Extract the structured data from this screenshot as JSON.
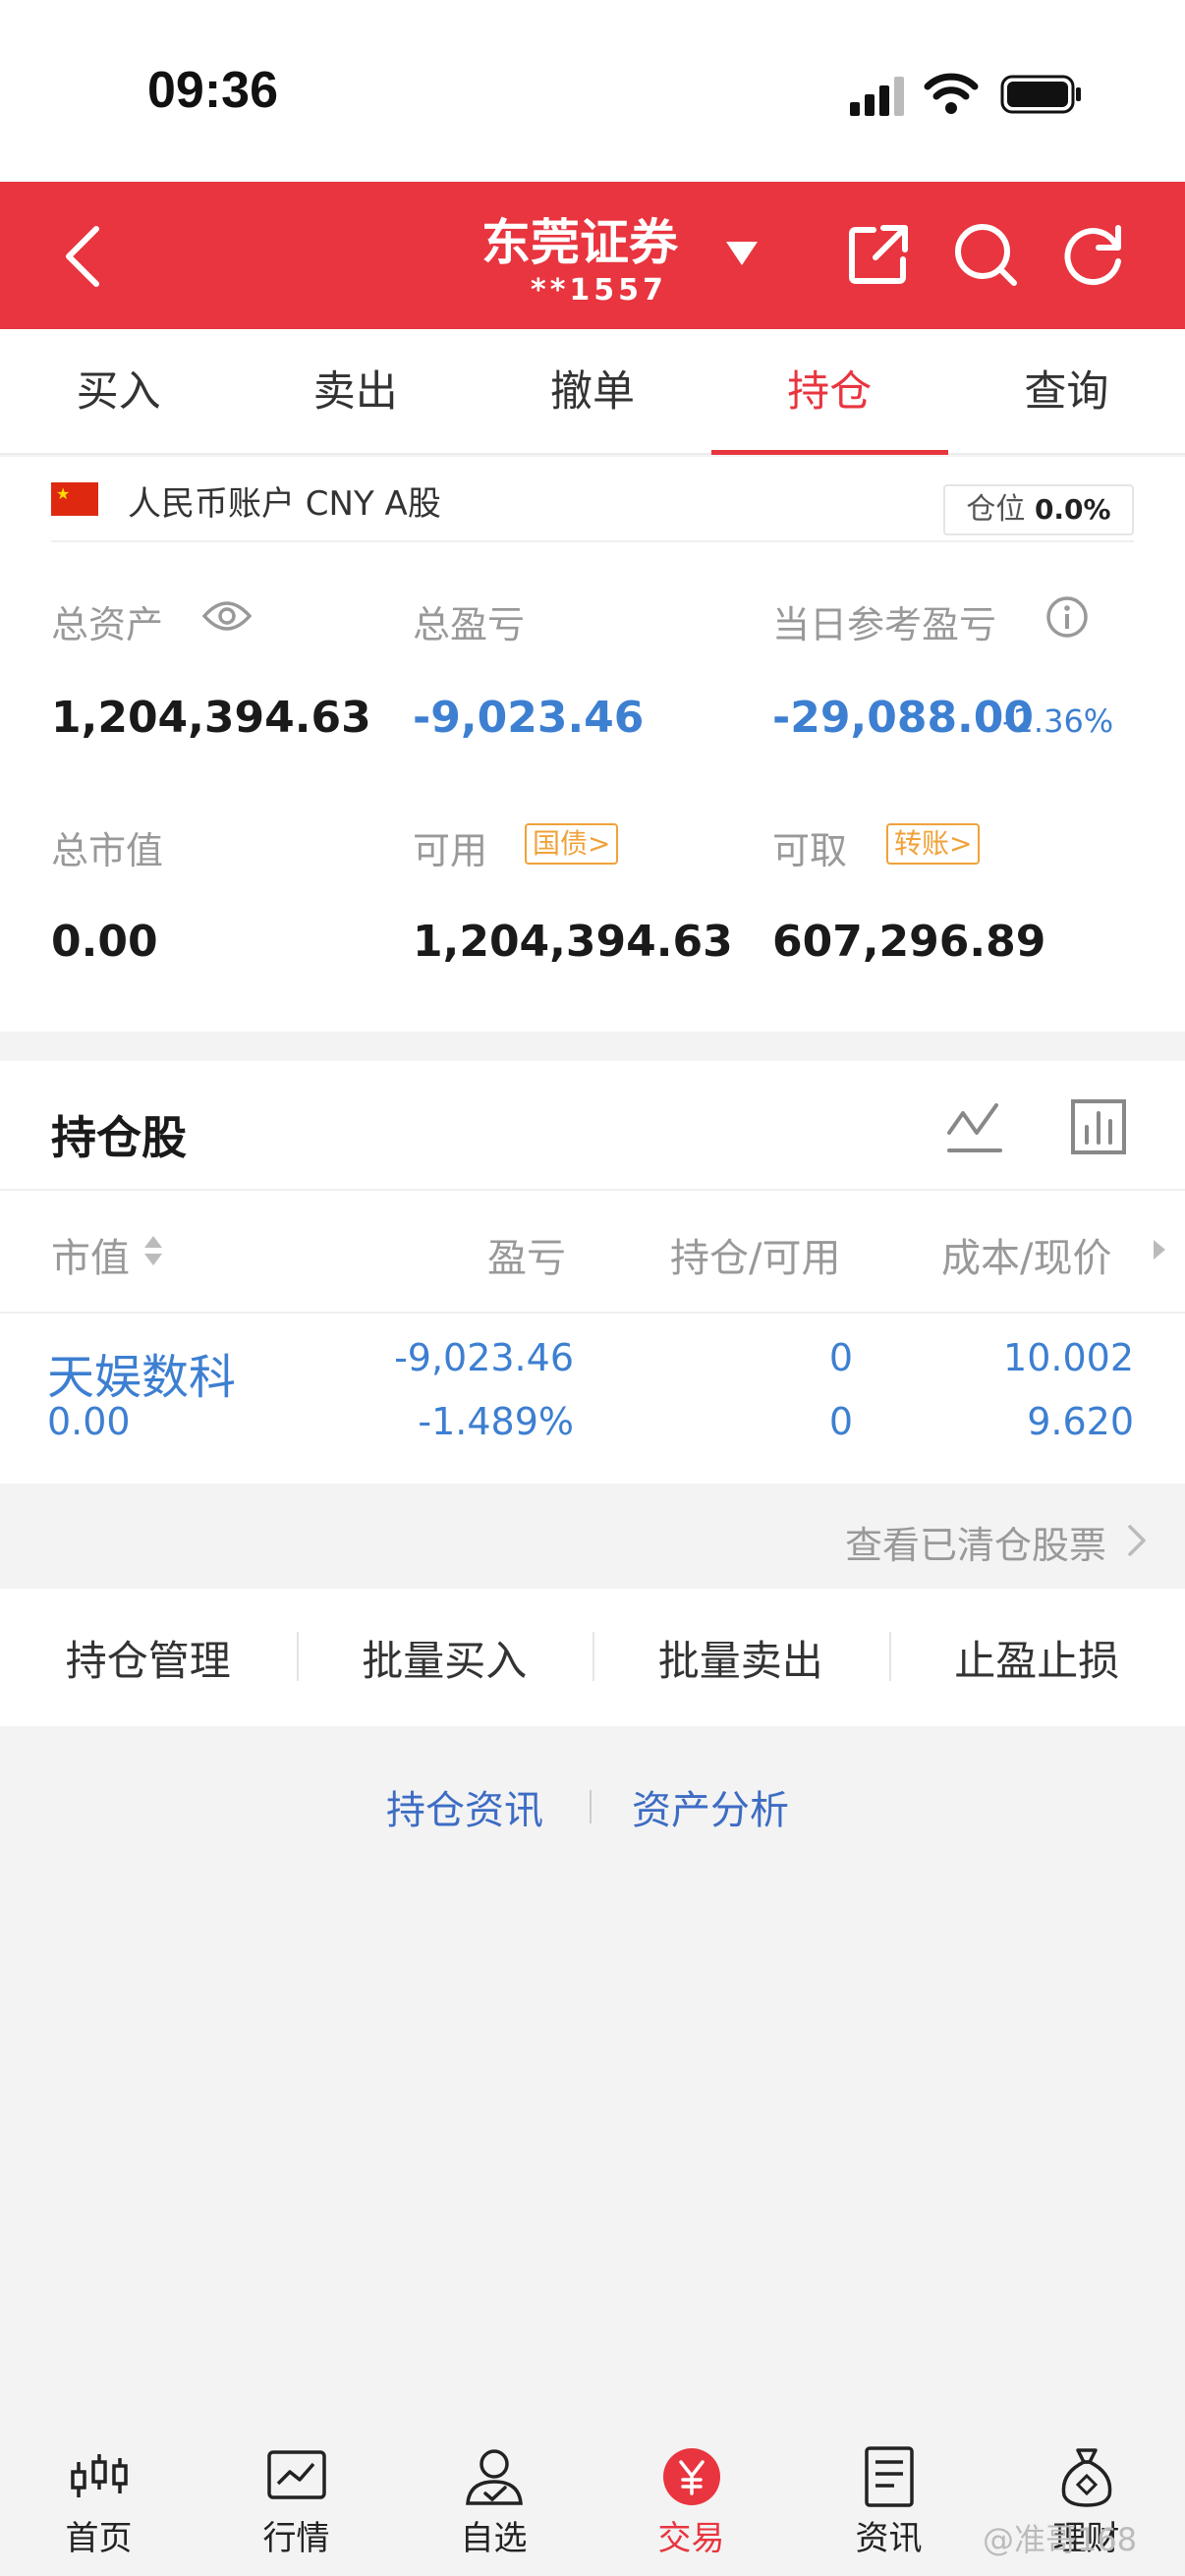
{
  "status_bar": {
    "time": "09:36"
  },
  "header": {
    "title": "东莞证券",
    "account_mask": "**1557",
    "icons": [
      "back-icon",
      "caret-down-icon",
      "share-icon",
      "search-icon",
      "refresh-icon"
    ]
  },
  "tabs": [
    {
      "label": "买入",
      "active": false
    },
    {
      "label": "卖出",
      "active": false
    },
    {
      "label": "撤单",
      "active": false
    },
    {
      "label": "持仓",
      "active": true
    },
    {
      "label": "查询",
      "active": false
    }
  ],
  "account": {
    "label": "人民币账户 CNY A股",
    "position_label": "仓位",
    "position_value": "0.0%",
    "total_assets_label": "总资产",
    "total_assets": "1,204,394.63",
    "total_pl_label": "总盈亏",
    "total_pl": "-9,023.46",
    "daily_pl_label": "当日参考盈亏",
    "daily_pl": "-29,088.00",
    "daily_pl_pct": "-2.36%",
    "market_value_label": "总市值",
    "market_value": "0.00",
    "available_label": "可用",
    "available_tag": "国债>",
    "available": "1,204,394.63",
    "withdrawable_label": "可取",
    "withdrawable_tag": "转账>",
    "withdrawable": "607,296.89"
  },
  "holdings": {
    "title": "持仓股",
    "columns": [
      "市值",
      "盈亏",
      "持仓/可用",
      "成本/现价"
    ],
    "rows": [
      {
        "name": "天娱数科",
        "market_value": "0.00",
        "pl": "-9,023.46",
        "pl_pct": "-1.489%",
        "position": "0",
        "available": "0",
        "cost": "10.002",
        "price": "9.620"
      }
    ],
    "cleared_link": "查看已清仓股票"
  },
  "actions": [
    "持仓管理",
    "批量买入",
    "批量卖出",
    "止盈止损"
  ],
  "links": [
    "持仓资讯",
    "资产分析"
  ],
  "bottom_nav": [
    {
      "label": "首页",
      "icon": "candlestick-icon",
      "active": false
    },
    {
      "label": "行情",
      "icon": "chart-icon",
      "active": false
    },
    {
      "label": "自选",
      "icon": "user-check-icon",
      "active": false
    },
    {
      "label": "交易",
      "icon": "yuan-icon",
      "active": true
    },
    {
      "label": "资讯",
      "icon": "document-icon",
      "active": false
    },
    {
      "label": "理财",
      "icon": "money-bag-icon",
      "active": false
    }
  ],
  "watermark": "@准哥168",
  "colors": {
    "brand_red": "#e8353f",
    "link_blue": "#3d7fd1",
    "tag_orange": "#f0a23a"
  }
}
